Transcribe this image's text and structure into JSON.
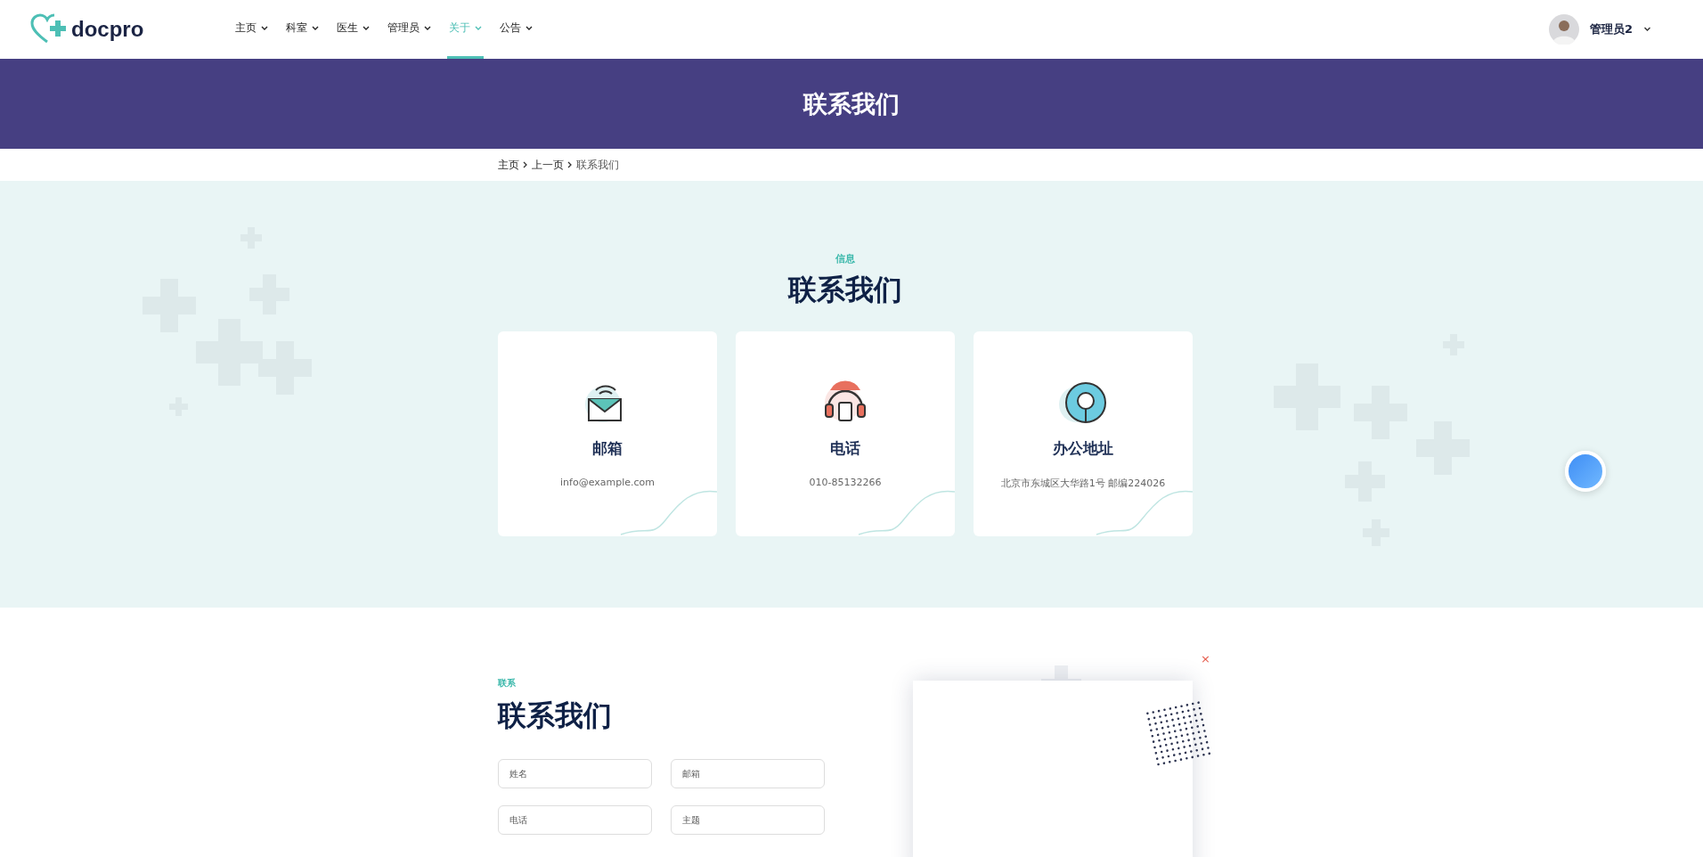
{
  "brand": {
    "name": "docpro"
  },
  "nav": [
    {
      "label": "主页",
      "selected": false
    },
    {
      "label": "科室",
      "selected": false
    },
    {
      "label": "医生",
      "selected": false
    },
    {
      "label": "管理员",
      "selected": false
    },
    {
      "label": "关于",
      "selected": true
    },
    {
      "label": "公告",
      "selected": false
    }
  ],
  "user": {
    "name": "管理员2"
  },
  "banner": {
    "title": "联系我们"
  },
  "breadcrumb": [
    {
      "label": "主页",
      "current": false
    },
    {
      "label": "上一页",
      "current": false
    },
    {
      "label": "联系我们",
      "current": true
    }
  ],
  "info": {
    "eyebrow": "信息",
    "heading": "联系我们",
    "cards": [
      {
        "kind": "email",
        "title": "邮箱",
        "text": "info@example.com"
      },
      {
        "kind": "phone",
        "title": "电话",
        "text": "010-85132266"
      },
      {
        "kind": "address",
        "title": "办公地址",
        "text": "北京市东城区大华路1号 邮编224026"
      }
    ]
  },
  "contact": {
    "eyebrow": "联系",
    "heading": "联系我们",
    "fields": [
      {
        "placeholder": "姓名"
      },
      {
        "placeholder": "邮箱"
      },
      {
        "placeholder": "电话"
      },
      {
        "placeholder": "主题"
      }
    ],
    "close": "×"
  }
}
